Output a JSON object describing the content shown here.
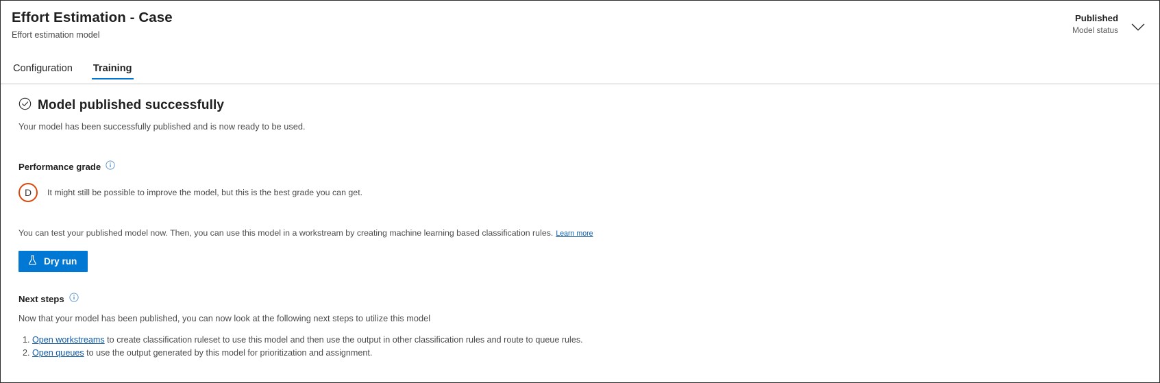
{
  "header": {
    "title": "Effort Estimation - Case",
    "subtitle": "Effort estimation model",
    "status_value": "Published",
    "status_label": "Model status",
    "chevron_icon": "chevron-down-icon"
  },
  "tabs": [
    {
      "label": "Configuration",
      "active": false
    },
    {
      "label": "Training",
      "active": true
    }
  ],
  "success": {
    "icon": "check-circle-icon",
    "title": "Model published successfully",
    "description": "Your model has been successfully published and is now ready to be used."
  },
  "performance": {
    "heading": "Performance grade",
    "info_icon": "info-icon",
    "grade": "D",
    "grade_color": "#d8480b",
    "grade_text": "It might still be possible to improve the model, but this is the best grade you can get."
  },
  "test": {
    "paragraph": "You can test your published model now. Then, you can use this model in a workstream by creating machine learning based classification rules.",
    "learn_more": "Learn more",
    "dry_run_label": "Dry run",
    "dry_run_icon": "flask-icon",
    "dry_run_color": "#0078d4"
  },
  "next_steps": {
    "heading": "Next steps",
    "info_icon": "info-icon",
    "description": "Now that your model has been published, you can now look at the following next steps to utilize this model",
    "items": [
      {
        "link": "Open workstreams",
        "text": " to create classification ruleset to use this model and then use the output in other classification rules and route to queue rules."
      },
      {
        "link": "Open queues",
        "text": " to use the output generated by this model for prioritization and assignment."
      }
    ]
  },
  "colors": {
    "accent": "#0078d4",
    "link": "#0f5aa6",
    "grade_orange": "#d8480b"
  }
}
